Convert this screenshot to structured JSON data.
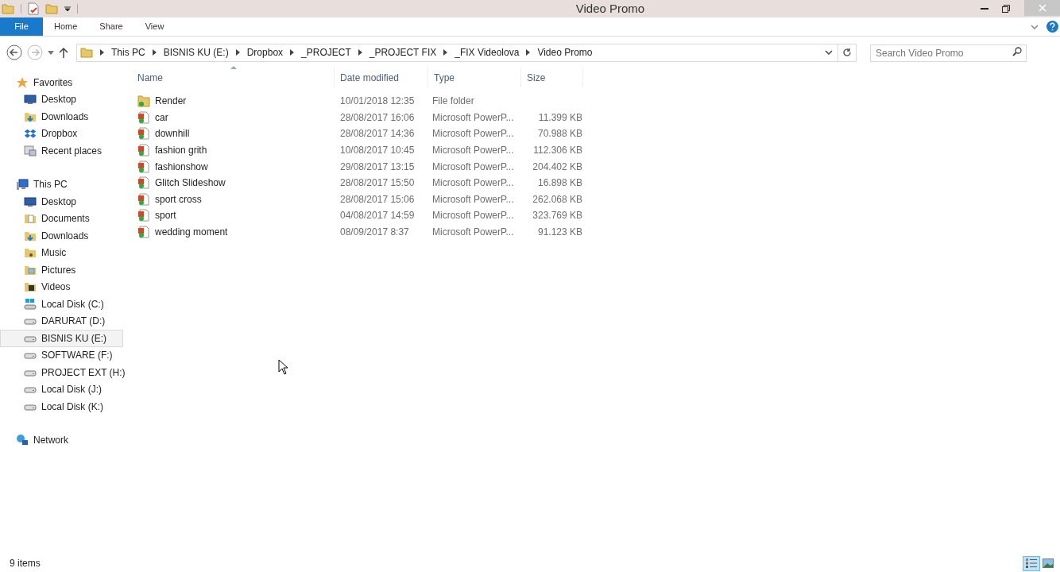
{
  "window": {
    "title": "Video Promo"
  },
  "ribbon_tabs": [
    {
      "label": "File",
      "selected": true
    },
    {
      "label": "Home",
      "selected": false
    },
    {
      "label": "Share",
      "selected": false
    },
    {
      "label": "View",
      "selected": false
    }
  ],
  "breadcrumb": [
    "This PC",
    "BISNIS KU (E:)",
    "Dropbox",
    "_PROJECT",
    "_PROJECT FIX",
    "_FIX Videolova",
    "Video Promo"
  ],
  "search": {
    "placeholder": "Search Video Promo"
  },
  "sidebar": [
    {
      "label": "Favorites",
      "kind": "star",
      "selected": false,
      "children": [
        {
          "label": "Desktop",
          "kind": "desktop",
          "selected": false
        },
        {
          "label": "Downloads",
          "kind": "downloads",
          "selected": false
        },
        {
          "label": "Dropbox",
          "kind": "dropbox",
          "selected": false
        },
        {
          "label": "Recent places",
          "kind": "recent",
          "selected": false
        }
      ]
    },
    {
      "label": "This PC",
      "kind": "pc",
      "selected": false,
      "children": [
        {
          "label": "Desktop",
          "kind": "desktop",
          "selected": false
        },
        {
          "label": "Documents",
          "kind": "documents",
          "selected": false
        },
        {
          "label": "Downloads",
          "kind": "downloads",
          "selected": false
        },
        {
          "label": "Music",
          "kind": "music",
          "selected": false
        },
        {
          "label": "Pictures",
          "kind": "pictures",
          "selected": false
        },
        {
          "label": "Videos",
          "kind": "videos",
          "selected": false
        },
        {
          "label": "Local Disk (C:)",
          "kind": "system-drive",
          "selected": false
        },
        {
          "label": "DARURAT (D:)",
          "kind": "drive",
          "selected": false
        },
        {
          "label": "BISNIS KU (E:)",
          "kind": "drive",
          "selected": true
        },
        {
          "label": "SOFTWARE (F:)",
          "kind": "drive",
          "selected": false
        },
        {
          "label": "PROJECT EXT (H:)",
          "kind": "drive",
          "selected": false
        },
        {
          "label": "Local Disk (J:)",
          "kind": "drive",
          "selected": false
        },
        {
          "label": "Local Disk (K:)",
          "kind": "drive",
          "selected": false
        }
      ]
    },
    {
      "label": "Network",
      "kind": "network",
      "selected": false
    }
  ],
  "table": {
    "columns": [
      "Name",
      "Date modified",
      "Type",
      "Size"
    ],
    "rows": [
      {
        "kind": "folder",
        "name": "Render",
        "date": "10/01/2018 12:35",
        "type": "File folder"
      },
      {
        "kind": "slides",
        "name": "car",
        "date": "28/08/2017 16:06",
        "type": "Microsoft PowerP...",
        "size": "11.399 KB"
      },
      {
        "kind": "slides",
        "name": "downhill",
        "date": "28/08/2017 14:36",
        "type": "Microsoft PowerP...",
        "size": "70.988 KB"
      },
      {
        "kind": "slides",
        "name": "fashion grith",
        "date": "10/08/2017 10:45",
        "type": "Microsoft PowerP...",
        "size": "112.306 KB"
      },
      {
        "kind": "slides",
        "name": "fashionshow",
        "date": "29/08/2017 13:15",
        "type": "Microsoft PowerP...",
        "size": "204.402 KB"
      },
      {
        "kind": "slides",
        "name": "Glitch Slideshow",
        "date": "28/08/2017 15:50",
        "type": "Microsoft PowerP...",
        "size": "16.898 KB"
      },
      {
        "kind": "slides",
        "name": "sport cross",
        "date": "28/08/2017 15:06",
        "type": "Microsoft PowerP...",
        "size": "262.068 KB"
      },
      {
        "kind": "slides",
        "name": "sport",
        "date": "04/08/2017 14:59",
        "type": "Microsoft PowerP...",
        "size": "323.769 KB"
      },
      {
        "kind": "slides",
        "name": "wedding moment",
        "date": "08/09/2017 8:37",
        "type": "Microsoft PowerP...",
        "size": "91.123 KB"
      }
    ]
  },
  "status_bar": {
    "count": "9 items"
  },
  "view_buttons": [
    {
      "kind": "details",
      "selected": true
    },
    {
      "kind": "large-icons",
      "selected": false
    }
  ]
}
